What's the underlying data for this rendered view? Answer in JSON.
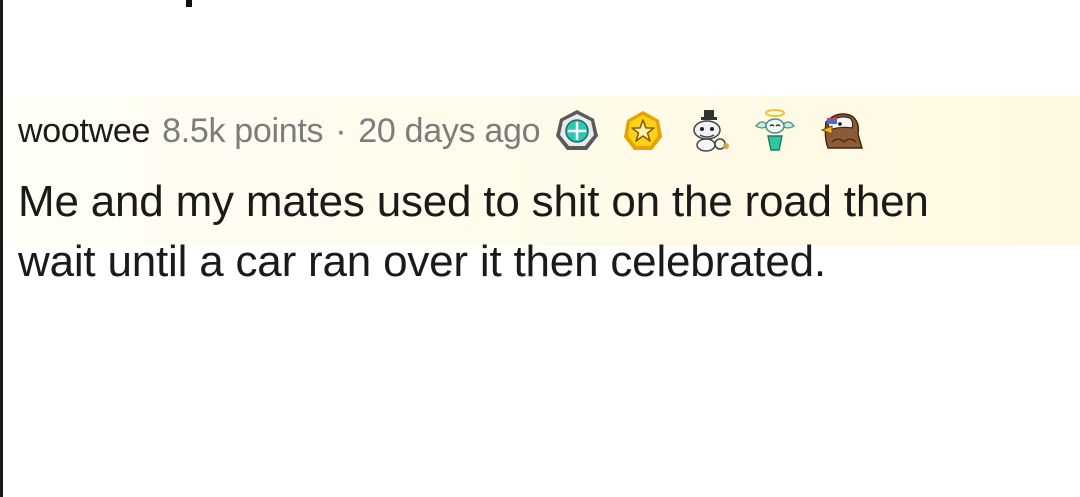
{
  "comment": {
    "username": "wootwee",
    "points": "8.5k points",
    "separator": "·",
    "age": "20 days ago",
    "body_line_1": "Me and my mates used to shit on the road then",
    "body_line_2": "wait until a car ran over it then celebrated.",
    "awards": [
      {
        "icon": "platinum-medal-icon"
      },
      {
        "icon": "gold-star-medal-icon"
      },
      {
        "icon": "gentleman-snoo-icon"
      },
      {
        "icon": "angel-snoo-icon"
      },
      {
        "icon": "eagle-icon"
      }
    ]
  },
  "colors": {
    "highlight": "#fffbe9",
    "username": "#1c1c1c",
    "meta": "#7c7c7c",
    "body": "#1a1a1a"
  }
}
